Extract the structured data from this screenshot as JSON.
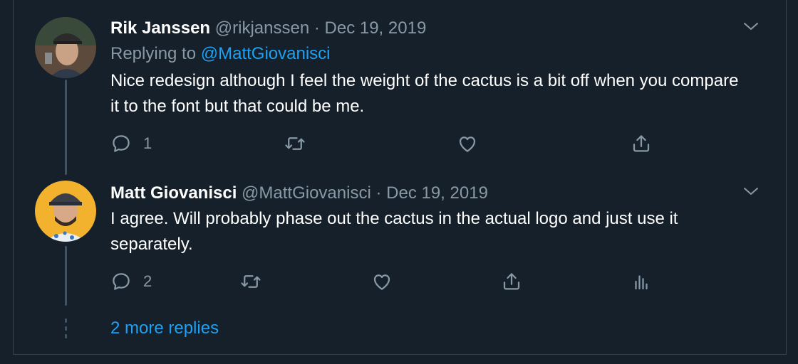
{
  "colors": {
    "background": "#15202b",
    "secondary_text": "#8899a6",
    "link": "#1da1f2",
    "thread_line": "#3d5466"
  },
  "tweets": [
    {
      "name": "Rik Janssen",
      "handle": "@rikjanssen",
      "separator": "·",
      "date": "Dec 19, 2019",
      "replying_prefix": "Replying to",
      "replying_to": "@MattGiovanisci",
      "text": "Nice redesign although I feel the weight of the cactus is a bit off when you compare it to the font but that could be me.",
      "reply_count": "1",
      "icons": [
        "reply-icon",
        "retweet-icon",
        "like-icon",
        "share-icon"
      ]
    },
    {
      "name": "Matt Giovanisci",
      "handle": "@MattGiovanisci",
      "separator": "·",
      "date": "Dec 19, 2019",
      "text": "I agree. Will probably phase out the cactus in the actual logo and just use it separately.",
      "reply_count": "2",
      "icons": [
        "reply-icon",
        "retweet-icon",
        "like-icon",
        "share-icon",
        "analytics-icon"
      ]
    }
  ],
  "more_replies": "2 more replies"
}
